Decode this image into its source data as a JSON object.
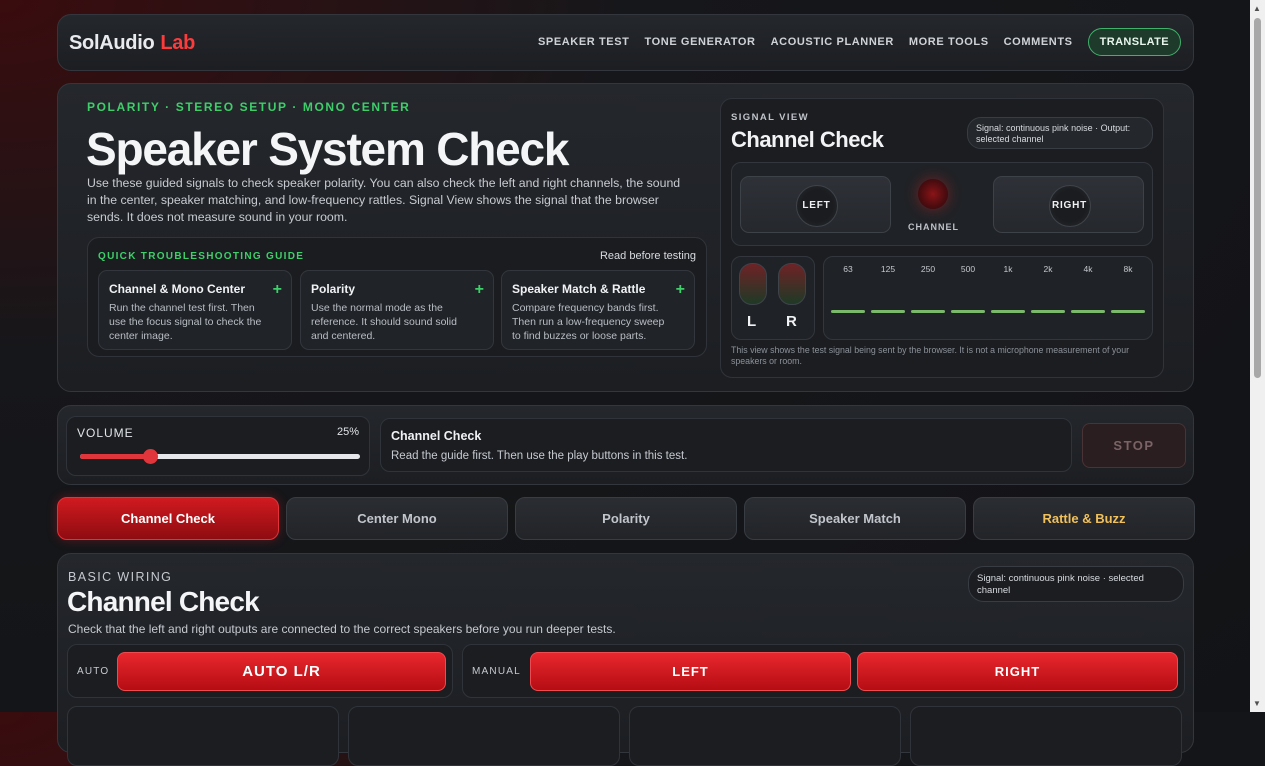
{
  "header": {
    "logo_main": "SolAudio",
    "logo_accent": "Lab",
    "nav": [
      "SPEAKER TEST",
      "TONE GENERATOR",
      "ACOUSTIC PLANNER",
      "MORE TOOLS",
      "COMMENTS"
    ],
    "translate_label": "TRANSLATE"
  },
  "hero": {
    "eyebrow": "POLARITY · STEREO SETUP · MONO CENTER",
    "title": "Speaker System Check",
    "description": "Use these guided signals to check speaker polarity. You can also check the left and right channels, the sound in the center, speaker matching, and low-frequency rattles. Signal View shows the signal that the browser sends. It does not measure sound in your room.",
    "guide": {
      "title": "QUICK TROUBLESHOOTING GUIDE",
      "note": "Read before testing",
      "cards": [
        {
          "title": "Channel & Mono Center",
          "text": "Run the channel test first. Then use the focus signal to check the center image."
        },
        {
          "title": "Polarity",
          "text": "Use the normal mode as the reference. It should sound solid and centered."
        },
        {
          "title": "Speaker Match & Rattle",
          "text": "Compare frequency bands first. Then run a low-frequency sweep to find buzzes or loose parts."
        }
      ]
    }
  },
  "signal_view": {
    "label": "SIGNAL VIEW",
    "title": "Channel Check",
    "pill": "Signal: continuous pink noise · Output: selected channel",
    "left_label": "LEFT",
    "right_label": "RIGHT",
    "channel_label": "CHANNEL",
    "vu_left": "L",
    "vu_right": "R",
    "bands": [
      "63",
      "125",
      "250",
      "500",
      "1k",
      "2k",
      "4k",
      "8k"
    ],
    "footnote": "This view shows the test signal being sent by the browser. It is not a microphone measurement of your speakers or room."
  },
  "controls": {
    "volume_label": "VOLUME",
    "volume_value": "25%",
    "volume_level": 0.25,
    "status_title": "Channel Check",
    "status_text": "Read the guide first. Then use the play buttons in this test.",
    "stop_label": "STOP"
  },
  "tabs": [
    "Channel Check",
    "Center Mono",
    "Polarity",
    "Speaker Match",
    "Rattle & Buzz"
  ],
  "section": {
    "eyebrow": "BASIC WIRING",
    "title": "Channel Check",
    "description": "Check that the left and right outputs are connected to the correct speakers before you run deeper tests.",
    "pill": "Signal: continuous pink noise · selected channel",
    "auto_label": "AUTO",
    "auto_button": "AUTO L/R",
    "manual_label": "MANUAL",
    "left_button": "LEFT",
    "right_button": "RIGHT"
  },
  "colors": {
    "accent_red": "#e0353b",
    "accent_green": "#3ecf6a",
    "warn_yellow": "#f0c05c"
  }
}
